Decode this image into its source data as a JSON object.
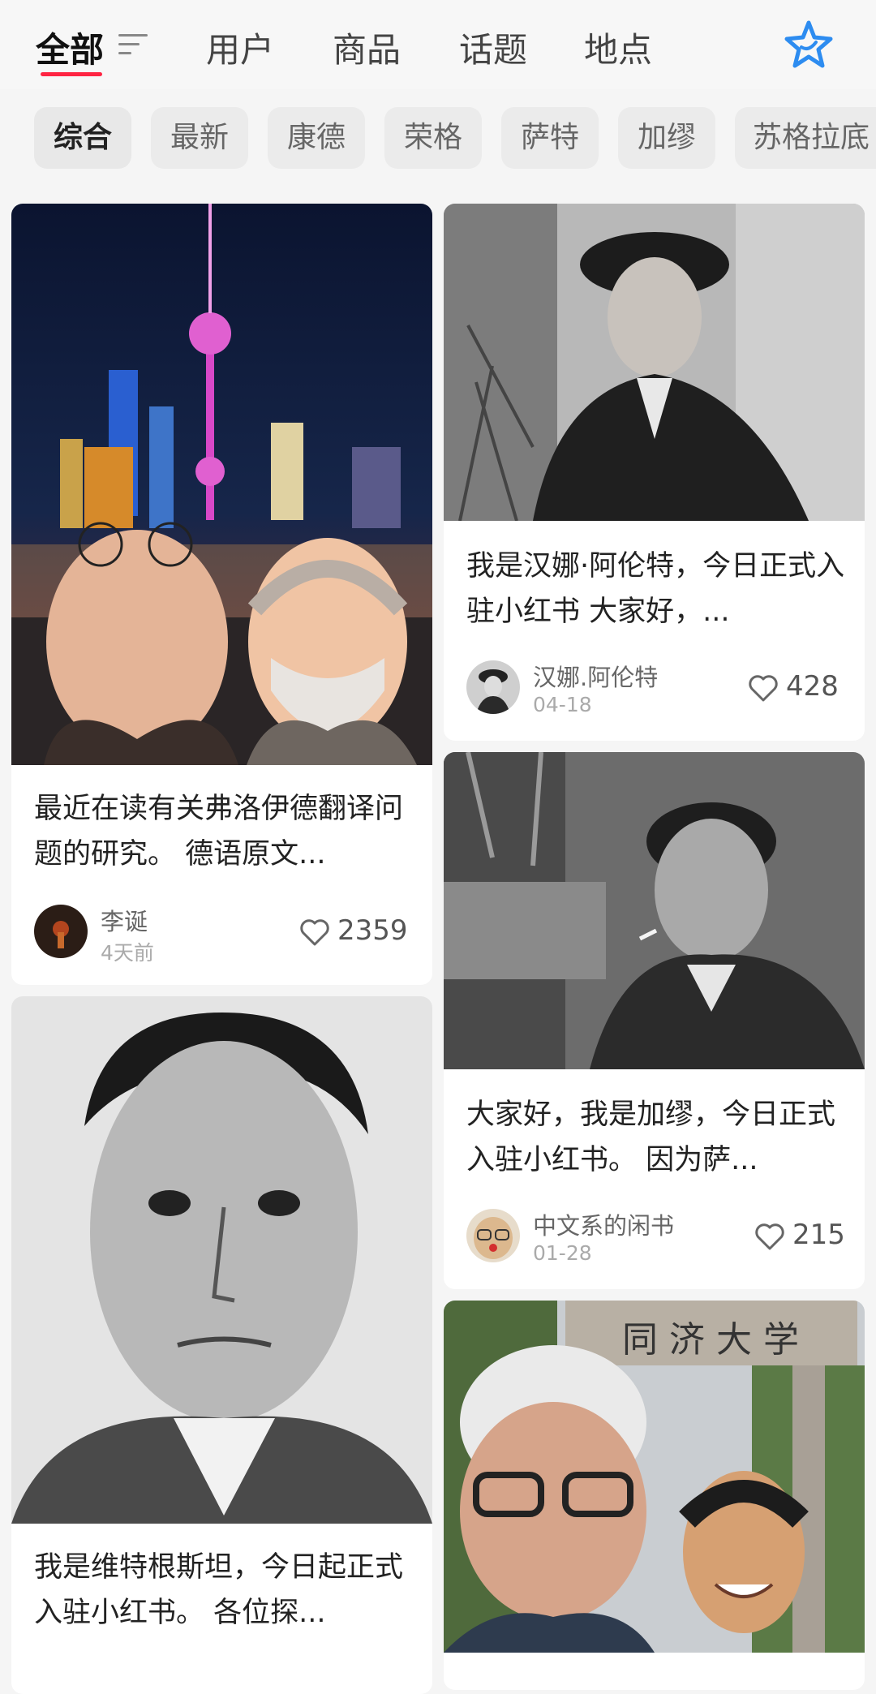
{
  "header": {
    "tabs": [
      {
        "label": "全部"
      },
      {
        "label": "用户"
      },
      {
        "label": "商品"
      },
      {
        "label": "话题"
      },
      {
        "label": "地点"
      }
    ]
  },
  "filter_chips": [
    "综合",
    "最新",
    "康德",
    "荣格",
    "萨特",
    "加缪",
    "苏格拉底"
  ],
  "feed": [
    {
      "title": "最近在读有关弗洛伊德翻译问题的研究。 德语原文...",
      "author": "李诞",
      "date": "4天前",
      "likes": "2359"
    },
    {
      "title": "我是汉娜·阿伦特，今日正式入驻小红书 大家好，...",
      "author": "汉娜.阿伦特",
      "date": "04-18",
      "likes": "428"
    },
    {
      "title": "大家好，我是加缪，今日正式入驻小红书。 因为萨...",
      "author": "中文系的闲书",
      "date": "01-28",
      "likes": "215"
    },
    {
      "title": "我是维特根斯坦，今日起正式入驻小红书。 各位探..."
    },
    {
      "sign_text": "同济大学"
    }
  ],
  "colors": {
    "accent": "#ff2442",
    "star_icon": "#2d8cf0"
  }
}
